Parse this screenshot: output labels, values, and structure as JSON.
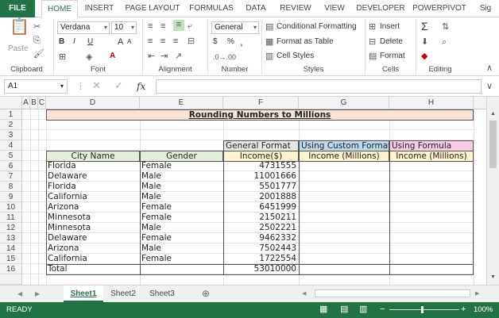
{
  "ribbon_tabs": [
    "FILE",
    "HOME",
    "INSERT",
    "PAGE LAYOUT",
    "FORMULAS",
    "DATA",
    "REVIEW",
    "VIEW",
    "DEVELOPER",
    "POWERPIVOT",
    "Sig"
  ],
  "clipboard": {
    "paste": "Paste",
    "label": "Clipboard"
  },
  "font": {
    "name": "Verdana",
    "size": "10",
    "bold": "B",
    "italic": "I",
    "underline": "U",
    "grow": "A",
    "shrink": "A",
    "label": "Font"
  },
  "alignment": {
    "label": "Alignment"
  },
  "number": {
    "format": "General",
    "currency": "$",
    "percent": "%",
    "comma": ",",
    "label": "Number"
  },
  "styles": {
    "conditional": "Conditional Formatting",
    "table": "Format as Table",
    "cell": "Cell Styles",
    "label": "Styles"
  },
  "cells": {
    "insert": "Insert",
    "delete": "Delete",
    "format": "Format",
    "label": "Cells"
  },
  "editing": {
    "sum": "Σ",
    "label": "Editing"
  },
  "formula_bar": {
    "name_box": "A1",
    "fx": "fx",
    "content": ""
  },
  "columns": [
    "A",
    "B",
    "C",
    "D",
    "E",
    "F",
    "G",
    "H"
  ],
  "rows": [
    "1",
    "2",
    "3",
    "4",
    "5",
    "6",
    "7",
    "8",
    "9",
    "10",
    "11",
    "12",
    "13",
    "14",
    "15",
    "16"
  ],
  "sheet": {
    "title": "Rounding Numbers to Millions",
    "group_headers": {
      "general": "General Format",
      "custom": "Using Custom Format",
      "formula": "Using Formula"
    },
    "headers": {
      "city": "City Name",
      "gender": "Gender",
      "income": "Income($)",
      "custom": "Income (Millions)",
      "formula": "Income (Millions)"
    },
    "data": [
      {
        "city": "Florida",
        "gender": "Female",
        "income": "4731555"
      },
      {
        "city": "Delaware",
        "gender": "Male",
        "income": "11001666"
      },
      {
        "city": "Florida",
        "gender": "Male",
        "income": "5501777"
      },
      {
        "city": "California",
        "gender": "Male",
        "income": "2001888"
      },
      {
        "city": "Arizona",
        "gender": "Female",
        "income": "6451999"
      },
      {
        "city": "Minnesota",
        "gender": "Female",
        "income": "2150211"
      },
      {
        "city": "Minnesota",
        "gender": "Male",
        "income": "2502221"
      },
      {
        "city": "Delaware",
        "gender": "Female",
        "income": "9462332"
      },
      {
        "city": "Arizona",
        "gender": "Male",
        "income": "7502443"
      },
      {
        "city": "California",
        "gender": "Female",
        "income": "1722554"
      }
    ],
    "total_label": "Total",
    "total_value": "53010000"
  },
  "sheet_tabs": [
    "Sheet1",
    "Sheet2",
    "Sheet3"
  ],
  "status": {
    "ready": "READY",
    "zoom": "100%"
  },
  "colors": {
    "excel_green": "#217346",
    "title_fill": "#fbe4d5",
    "general_fill": "#e7e6e6",
    "custom_fill": "#bdd7ee",
    "formula_fill": "#f8cbe4",
    "income_header_fill": "#fff2cc",
    "table_header_fill": "#e2efda"
  }
}
